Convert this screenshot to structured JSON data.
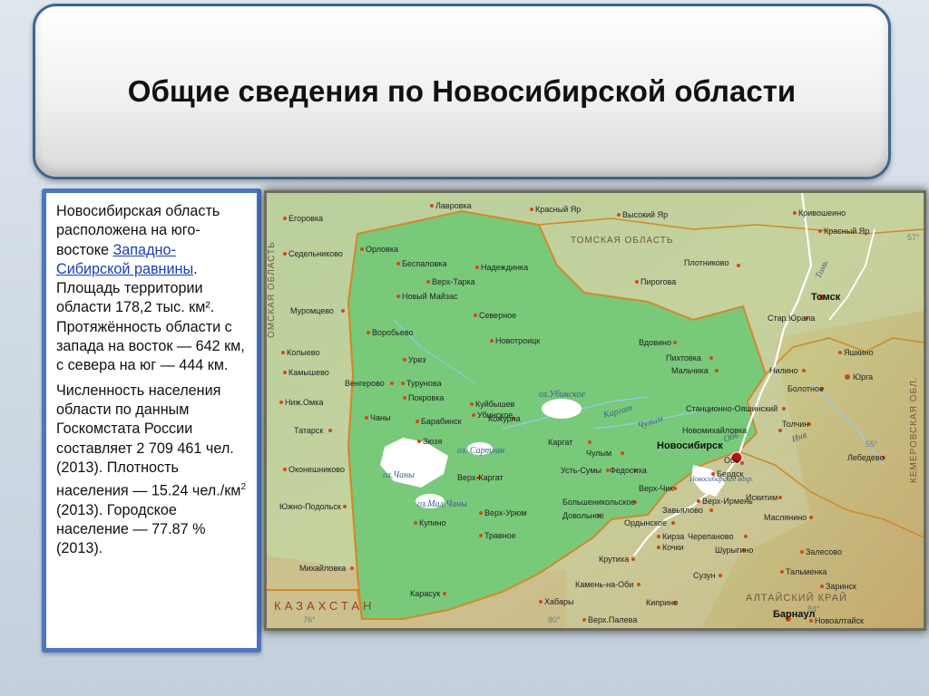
{
  "title": "Общие сведения по Новосибирской области",
  "text": {
    "p1_before_link": "Новосибирская область расположена на юго-востоке ",
    "p1_link": "Западно-Сибирской равнины",
    "p1_after_link": ". Площадь территории области 178,2 тыс. км². Протяжённость области с запада на восток — 642 км, с севера на юг — 444 км.",
    "p2_before_sup": "Численность населения области по данным Госкомстата России составляет 2 709 461 чел. (2013). Плотность населения — 15.24 чел./км",
    "p2_sup": "2",
    "p2_after_sup": " (2013). Городское население — 77.87 % (2013)."
  },
  "map": {
    "regions": {
      "tomsk": "ТОМСКАЯ ОБЛАСТЬ",
      "omsk": "ОМСКАЯ ОБЛАСТЬ",
      "kazakhstan": "КАЗАХСТАН",
      "altai": "АЛТАЙСКИЙ КРАЙ",
      "kemerovo": "КЕМЕРОВСКАЯ ОБЛ."
    },
    "rivers": {
      "kargat": "Каргат",
      "chulym": "Чулым",
      "tom": "Томь",
      "inya": "Иня",
      "ob": "Обь"
    },
    "lakes": {
      "ubinskoe": "оз.Убинское",
      "sartlan": "оз. Сартлан",
      "chany": "оз.Чаны",
      "mal_chany": "оз.Мал.Чаны",
      "reservoir": "Новосибирское вдхр."
    },
    "degrees": {
      "d57": "57°",
      "d55": "55°",
      "d76": "76°",
      "d80": "80°",
      "d84": "84°"
    },
    "capital": "Новосибирск",
    "cities": {
      "tomsk": "Томск",
      "barnaul": "Барнаул",
      "egorovka": "Егоровка",
      "lavrovka": "Лавровка",
      "krasny_yar1": "Красный Яр",
      "vysoky_yar": "Высокий Яр",
      "krivoshein": "Кривошеино",
      "krasny_yar2": "Красный Яр",
      "sedelnikovo": "Седельниково",
      "orlovka": "Орловка",
      "belyaevka": "Беспаловка",
      "nadezhdinka": "Надеждинка",
      "verkh_tarka": "Верх-Тарка",
      "novy_maizas": "Новый Майзас",
      "plotnikovo": "Плотниково",
      "pirogovka": "Пирогова",
      "muromcevo": "Муромцево",
      "severnoe": "Северное",
      "star_yuala": "Стар.Юрала",
      "vorobyevo": "Воробьево",
      "novotroick": "Новотроицк",
      "vdovino": "Вдовино",
      "yashkino": "Яшкино",
      "kolyevo": "Колыево",
      "urez": "Урез",
      "pikhtovka": "Пихтовка",
      "malchika": "Мальчика",
      "nilino": "Нилино",
      "yurga": "Юрга",
      "kamyshevo": "Камышево",
      "vengerovo": "Венгерово",
      "turunovka": "Турунова",
      "bolotnoe": "Болотное",
      "pokrovka": "Покровка",
      "kuibyshev": "Куйбышев",
      "ubinskoe": "Убинское",
      "stancionno": "Станционно-Ояшинский",
      "niz_omka": "Ниж.Омка",
      "chany": "Чаны",
      "barabinsk": "Барабинск",
      "kozhurla": "Кожурла",
      "novomikhaylovka": "Новомихайловка",
      "tolchin": "Толчин",
      "tatarsk": "Татарск",
      "kargat": "Каргат",
      "ob": "Обь",
      "zyuzya": "Зюзя",
      "chulym": "Чулым",
      "lebedevo": "Лебедево",
      "okoneshnikovo": "Оконешниково",
      "verkh_kargat": "Верх-Каргат",
      "ust_sum": "Усть-Сумы",
      "fedosikha": "Федосиха",
      "berdsk": "Бердск",
      "verkh_chik": "Верх-Чик",
      "verkh_irmen": "Верх-Ирмень",
      "iskitim": "Искитим",
      "bolshenikolskoe": "Большеникольское",
      "yuzhno_podolsk": "Южно-Подольск",
      "verkh_uryum": "Верх-Урюм",
      "dovolnoe": "Довольное",
      "zavyalovo": "Завьялово",
      "ordynskoe": "Ордынское",
      "maslyanino": "Маслянино",
      "kupino": "Купино",
      "travnoe": "Травное",
      "kirza": "Кирза",
      "cherepanovo": "Черепаново",
      "kochki": "Кочки",
      "shurygino": "Шурыгино",
      "krutikha": "Крутиха",
      "zalesovo": "Залесово",
      "mikhaylovka": "Михайловка",
      "suzun": "Сузун",
      "talmenka": "Тальменка",
      "karasuk": "Карасук",
      "kamen": "Камень-на-Оби",
      "zarinsk": "Заринск",
      "khabary": "Хабары",
      "kiprino": "Киприно",
      "verkh_paleva": "Верх.Палева",
      "novoaltaysk": "Новоалтайск"
    }
  },
  "colors": {
    "title_border": "#3e6690",
    "panel_border": "#4a77c0",
    "region_fill": "#79c97a",
    "border_line": "#d08a2b",
    "water": "#ffffff",
    "city_dot": "#d24a14"
  }
}
